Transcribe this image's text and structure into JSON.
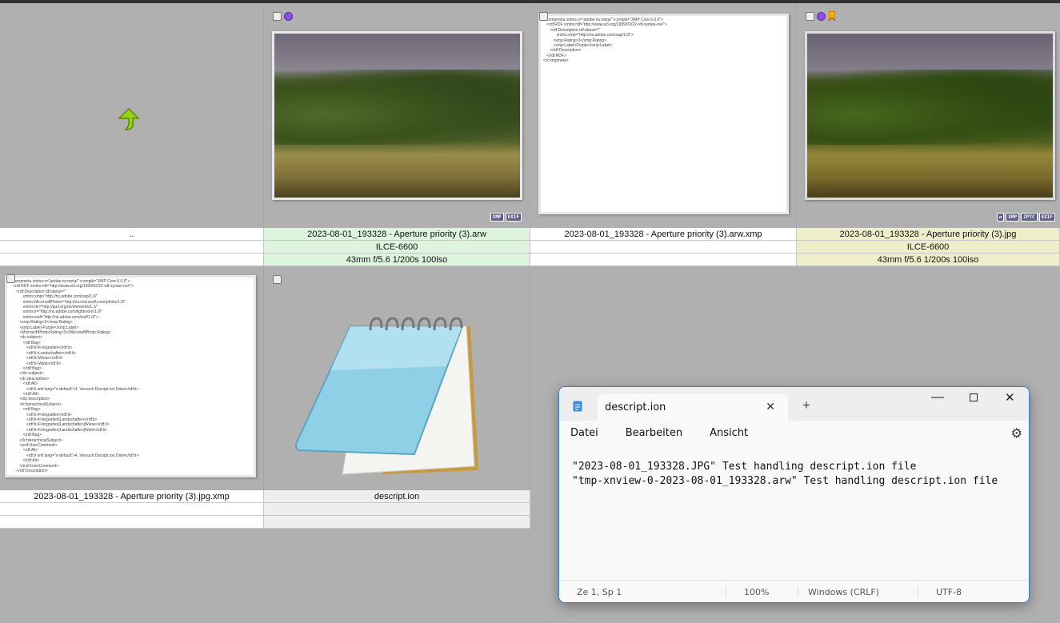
{
  "items": [
    {
      "name": "..",
      "line2": "",
      "line3": ""
    },
    {
      "name": "2023-08-01_193328 - Aperture priority (3).arw",
      "line2": "ILCE-6600",
      "line3": "43mm f/5.6 1/200s 100iso",
      "badges": [
        "XMP",
        "EXIF"
      ]
    },
    {
      "name": "2023-08-01_193328 - Aperture priority (3).arw.xmp",
      "line2": "",
      "line3": ""
    },
    {
      "name": "2023-08-01_193328 - Aperture priority (3).jpg",
      "line2": "ILCE-6600",
      "line3": "43mm f/5.6 1/200s 100iso",
      "badges": [
        "IPTC",
        "XMP",
        "EXIF"
      ]
    },
    {
      "name": "2023-08-01_193328 - Aperture priority (3).jpg.xmp",
      "line2": "",
      "line3": ""
    },
    {
      "name": "descript.ion",
      "line2": "",
      "line3": ""
    }
  ],
  "xmp_small": "<x:xmpmeta xmlns:x=\"adobe:ns:meta/\" x:xmptk=\"XMP Core 6.0.0\">\n   <rdf:RDF xmlns:rdf=\"http://www.w3.org/1999/02/22-rdf-syntax-ns#\">\n      <rdf:Description rdf:about=\"\"\n            xmlns:xmp=\"http://ns.adobe.com/xap/1.0/\">\n         <xmp:Rating>3</xmp:Rating>\n         <xmp:Label>Purple</xmp:Label>\n      </rdf:Description>\n   </rdf:RDF>\n</x:xmpmeta>",
  "xmp_large": "<x:xmpmeta xmlns:x=\"adobe:ns:meta/\" x:xmptk=\"XMP Core 6.0.0\">\n   <rdf:RDF xmlns:rdf=\"http://www.w3.org/1999/02/22-rdf-syntax-ns#\">\n      <rdf:Description rdf:about=\"\"\n            xmlns:xmp=\"http://ns.adobe.com/xap/1.0/\"\n            xmlns:MicrosoftPhoto=\"http://ns.microsoft.com/photo/1.0/\"\n            xmlns:dc=\"http://purl.org/dc/elements/1.1/\"\n            xmlns:lr=\"http://ns.adobe.com/lightroom/1.0/\"\n            xmlns:exif=\"http://ns.adobe.com/exif/1.0/\">\n         <xmp:Rating>3</xmp:Rating>\n         <xmp:Label>Purple</xmp:Label>\n         <MicrosoftPhoto:Rating>3</MicrosoftPhoto:Rating>\n         <dc:subject>\n            <rdf:Bag>\n               <rdf:li>Fotografien</rdf:li>\n               <rdf:li>Landschaften</rdf:li>\n               <rdf:li>Wiese</rdf:li>\n               <rdf:li>Wald</rdf:li>\n            </rdf:Bag>\n         </dc:subject>\n         <dc:description>\n            <rdf:Alt>\n               <rdf:li xml:lang=\"x-default\">4. Versuch Discript.ion Datei</rdf:li>\n            </rdf:Alt>\n         </dc:description>\n         <lr:hierarchicalSubject>\n            <rdf:Bag>\n               <rdf:li>Fotografien</rdf:li>\n               <rdf:li>Fotografien|Landschaften</rdf:li>\n               <rdf:li>Fotografien|Landschaften|Wiese</rdf:li>\n               <rdf:li>Fotografien|Landschaften|Wald</rdf:li>\n            </rdf:Bag>\n         </lr:hierarchicalSubject>\n         <exif:UserComment>\n            <rdf:Alt>\n               <rdf:li xml:lang=\"x-default\">4. Versuch Discript.ion Datei</rdf:li>\n            </rdf:Alt>\n         </exif:UserComment>\n      </rdf:Description>",
  "notepad": {
    "tab_title": "descript.ion",
    "menu": [
      "Datei",
      "Bearbeiten",
      "Ansicht"
    ],
    "content": "\"2023-08-01_193328.JPG\" Test handling descript.ion file\n\"tmp-xnview-0-2023-08-01_193328.arw\" Test handling descript.ion file",
    "status": {
      "position": "Ze 1, Sp 1",
      "zoom": "100%",
      "line_ending": "Windows (CRLF)",
      "encoding": "UTF-8"
    }
  },
  "colors": {
    "label_purple": "#8a4fe8",
    "selected_green": "#dcf5dc",
    "selected_yellow": "#eeeecb"
  }
}
